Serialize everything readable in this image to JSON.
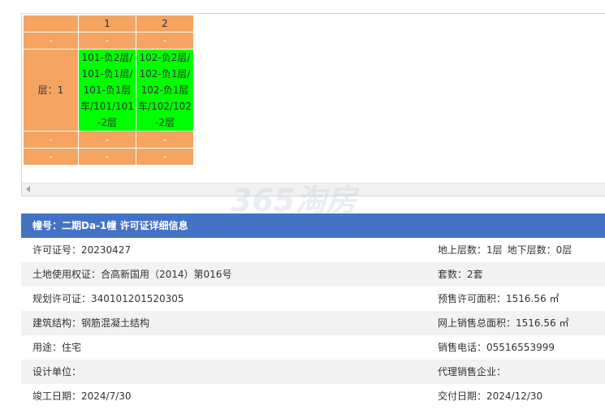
{
  "grid": {
    "columns": [
      "1",
      "2"
    ],
    "dash": "-",
    "rows": [
      {
        "type": "dash"
      },
      {
        "type": "floor",
        "floor_label": "层：1",
        "units": [
          "101-负2层/101-负1层/101-负1层车/101/101-2层",
          "102-负2层/102-负1层/102-负1层车/102/102-2层"
        ],
        "status_color": "#00ff00"
      },
      {
        "type": "dash"
      },
      {
        "type": "dash"
      }
    ]
  },
  "detail": {
    "title": "幢号：二期Da-1幢 许可证详细信息",
    "rows": [
      {
        "left": "许可证号：20230427",
        "right": "地上层数：1层",
        "right2": "地下层数：0层"
      },
      {
        "left": "土地使用权证：合高新国用（2014）第016号",
        "right": "套数：2套"
      },
      {
        "left": "规划许可证：340101201520305",
        "right": "预售许可面积：1516.56 ㎡"
      },
      {
        "left": "建筑结构：钢筋混凝土结构",
        "right": "网上销售总面积：1516.56 ㎡"
      },
      {
        "left": "用途：住宅",
        "right": "销售电话：05516553999"
      },
      {
        "left": "设计单位：",
        "right": "代理销售企业："
      },
      {
        "left": "竣工日期：2024/7/30",
        "right": "交付日期：2024/12/30"
      }
    ]
  },
  "watermark": {
    "brand": "365淘房",
    "url": "www.house365.com"
  },
  "colors": {
    "header": "#f5a462",
    "available": "#00ff00",
    "title_bar": "#4472c4"
  }
}
